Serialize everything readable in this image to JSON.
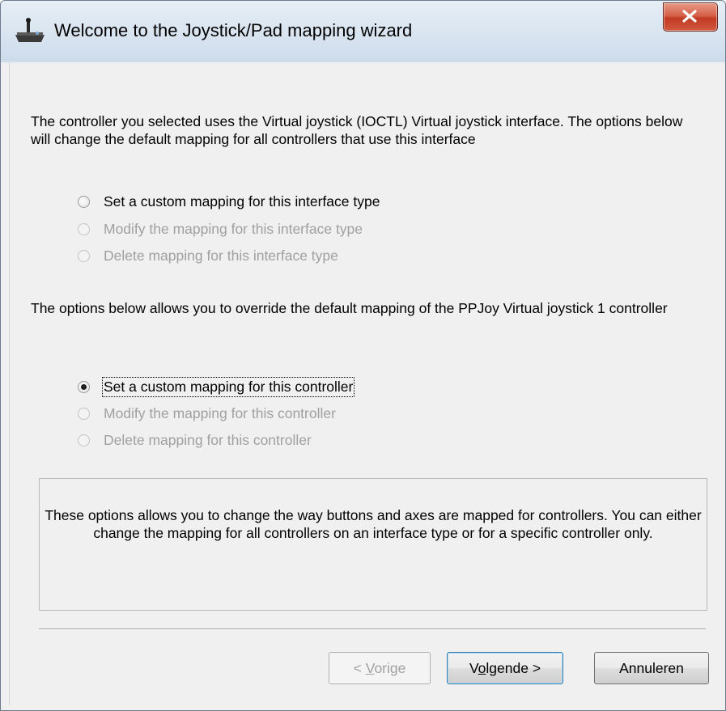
{
  "window": {
    "title": "Welcome to the Joystick/Pad mapping wizard",
    "icon": "joystick-icon",
    "close_icon": "close-icon",
    "close_color": "#c9452c"
  },
  "intro": {
    "interface_text": "The controller you selected uses the Virtual joystick (IOCTL) Virtual joystick interface. The options below will change the default mapping for all controllers that use this interface",
    "controller_text": "The options below allows you to override the default mapping of the PPJoy Virtual joystick 1 controller"
  },
  "interface_options": [
    {
      "label": "Set a custom mapping for this interface type",
      "enabled": true,
      "selected": false
    },
    {
      "label": "Modify the mapping for this interface type",
      "enabled": false,
      "selected": false
    },
    {
      "label": "Delete mapping for this interface type",
      "enabled": false,
      "selected": false
    }
  ],
  "controller_options": [
    {
      "label": "Set a custom mapping for this controller",
      "enabled": true,
      "selected": true
    },
    {
      "label": "Modify the mapping for this controller",
      "enabled": false,
      "selected": false
    },
    {
      "label": "Delete mapping for this controller",
      "enabled": false,
      "selected": false
    }
  ],
  "info": {
    "text": "These options allows you to change the way buttons and axes are mapped for controllers. You can either change the mapping for all controllers on an interface type or for a specific controller only."
  },
  "buttons": {
    "back": {
      "prefix": "< ",
      "accel": "V",
      "rest": "orige",
      "enabled": false
    },
    "next": {
      "prefix": "V",
      "accel": "o",
      "rest": "lgende >",
      "enabled": true
    },
    "cancel": {
      "label": "Annuleren",
      "enabled": true
    }
  }
}
